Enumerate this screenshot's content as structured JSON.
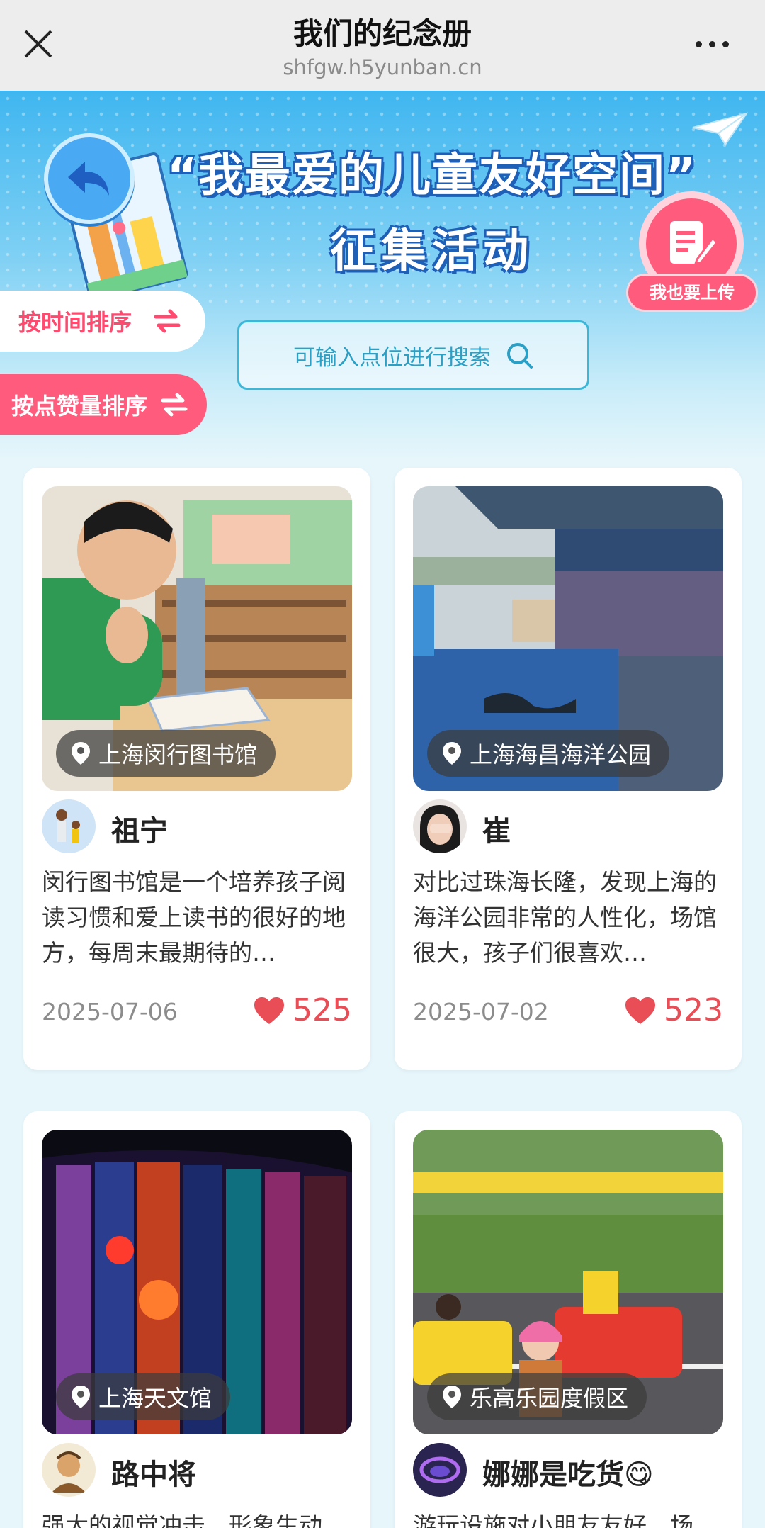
{
  "topbar": {
    "title": "我们的纪念册",
    "url": "shfgw.h5yunban.cn"
  },
  "banner": {
    "headline_line1": "“我最爱的儿童友好空间”",
    "headline_line2": "征集活动",
    "upload_label": "我也要上传",
    "sort_time_label": "按时间排序",
    "sort_likes_label": "按点赞量排序",
    "search_placeholder": "可输入点位进行搜索"
  },
  "cards": [
    {
      "location": "上海闵行图书馆",
      "user": "祖宁",
      "description": "闵行图书馆是一个培养孩子阅读习惯和爱上读书的很好的地方，每周末最期待的…",
      "date": "2025-07-06",
      "likes": "525"
    },
    {
      "location": "上海海昌海洋公园",
      "user": "崔",
      "description": "对比过珠海长隆，发现上海的海洋公园非常的人性化，场馆很大，孩子们很喜欢…",
      "date": "2025-07-02",
      "likes": "523"
    },
    {
      "location": "上海天文馆",
      "user": "路中将",
      "description": "强大的视觉冲击，形象生动"
    },
    {
      "location": "乐高乐园度假区",
      "user": "娜娜是吃货😋",
      "description": "游玩设施对小朋友友好，场"
    }
  ],
  "colors": {
    "accent_pink": "#ff5b7d",
    "accent_blue": "#3cb7d8",
    "like_red": "#e94d55"
  }
}
